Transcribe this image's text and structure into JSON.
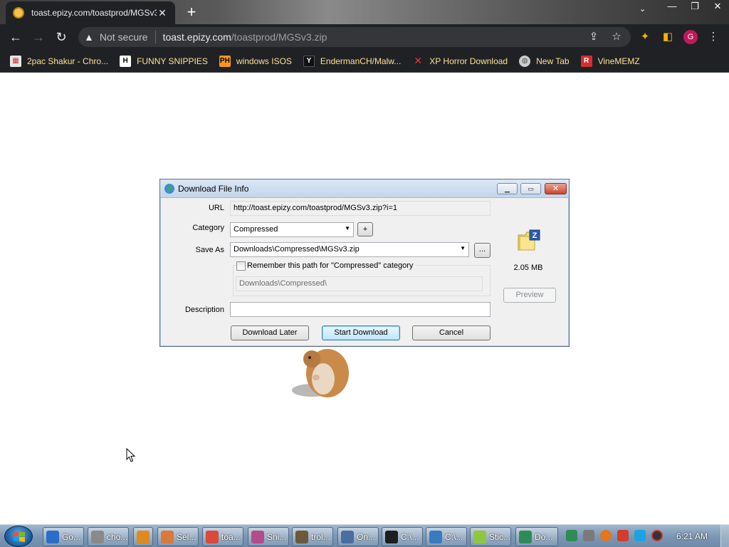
{
  "browser": {
    "tab": {
      "title": "toast.epizy.com/toastprod/MGSv3"
    },
    "omnibox": {
      "security_label": "Not secure",
      "host": "toast.epizy.com",
      "path": "/toastprod/MGSv3.zip"
    },
    "avatar_letter": "G",
    "bookmarks": [
      {
        "label": "2pac Shakur - Chro...",
        "icon": "store-icon"
      },
      {
        "label": "FUNNY SNIPPIES",
        "icon": "h-icon"
      },
      {
        "label": "windows ISOS",
        "icon": "ph-icon"
      },
      {
        "label": "EndermanCH/Malw...",
        "icon": "yp-icon"
      },
      {
        "label": "XP Horror Download",
        "icon": "x-icon"
      },
      {
        "label": "New Tab",
        "icon": "globe-icon"
      },
      {
        "label": "VineMEMZ",
        "icon": "r-icon"
      }
    ]
  },
  "dialog": {
    "title": "Download File Info",
    "url_label": "URL",
    "url_value": "http://toast.epizy.com/toastprod/MGSv3.zip?i=1",
    "category_label": "Category",
    "category_value": "Compressed",
    "add_category_label": "+",
    "save_as_label": "Save As",
    "save_as_value": "Downloads\\Compressed\\MGSv3.zip",
    "browse_label": "...",
    "remember_label": "Remember this path for \"Compressed\" category",
    "remember_checked": false,
    "remember_path": "Downloads\\Compressed\\",
    "description_label": "Description",
    "description_value": "",
    "file_size": "2.05 MB",
    "preview_label": "Preview",
    "buttons": {
      "download_later": "Download Later",
      "start_download": "Start Download",
      "cancel": "Cancel"
    }
  },
  "taskbar": {
    "items": [
      {
        "label": "Go...",
        "icon": "ie-icon",
        "color": "#2a6ec9"
      },
      {
        "label": "cho...",
        "icon": "app-icon",
        "color": "#8a8a8a"
      },
      {
        "label": "",
        "icon": "media-icon",
        "color": "#e08a1e"
      },
      {
        "label": "Sel...",
        "icon": "mascot-icon",
        "color": "#d9793a"
      },
      {
        "label": "toa...",
        "icon": "chrome-icon",
        "color": "#d94a3a"
      },
      {
        "label": "Sni...",
        "icon": "snipping-icon",
        "color": "#b44c8c"
      },
      {
        "label": "trol...",
        "icon": "app-icon",
        "color": "#6b5a3a"
      },
      {
        "label": "On...",
        "icon": "keyboard-icon",
        "color": "#4a6ea0"
      },
      {
        "label": "C:\\...",
        "icon": "7zip-icon",
        "color": "#1e1e1e"
      },
      {
        "label": "C:\\...",
        "icon": "window-icon",
        "color": "#3a7ac0"
      },
      {
        "label": "Stic...",
        "icon": "sticky-icon",
        "color": "#8fc63f"
      },
      {
        "label": "Do...",
        "icon": "idm-icon",
        "color": "#2e8b57"
      }
    ],
    "clock": "6:21 AM"
  }
}
